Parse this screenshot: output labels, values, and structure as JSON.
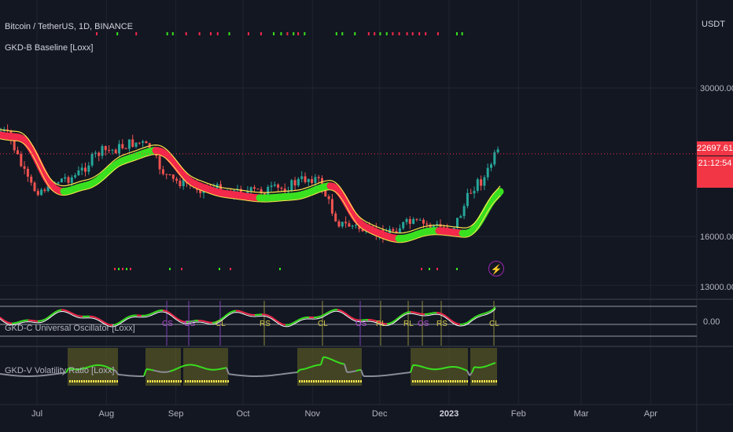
{
  "header": {
    "symbol": "Bitcoin / TetherUS, 1D, BINANCE",
    "indicator": "GKD-B Baseline [Loxx]",
    "quote_currency": "USDT"
  },
  "panes": {
    "oscillator_label": "GKD-C Universal Oscillator [Loxx]",
    "volatility_label": "GKD-V Volatility Ratio [Loxx]"
  },
  "price_axis": {
    "ticks": [
      "30000.00",
      "16000.00",
      "13000.00"
    ],
    "oscillator_tick": "0.00"
  },
  "last_price": {
    "value": "22697.61",
    "countdown": "21:12:54",
    "color": "#f23645"
  },
  "time_axis": {
    "labels": [
      "Jul",
      "Aug",
      "Sep",
      "Oct",
      "Nov",
      "Dec",
      "2023",
      "Feb",
      "Mar",
      "Apr"
    ]
  },
  "oscillator_signals": [
    "CS",
    "OS",
    "CL",
    "RS",
    "CL",
    "OS",
    "RL",
    "RL",
    "OS",
    "RS",
    "CL"
  ],
  "colors": {
    "background": "#131722",
    "bull": "#39e01f",
    "bear": "#f2294a",
    "signal_line": "#ffe84d",
    "volatility_zone": "#6b6a27",
    "grid": "#1f2430"
  },
  "chart_data": {
    "type": "line",
    "x": [
      "2022-06-15",
      "2022-07-01",
      "2022-07-15",
      "2022-08-01",
      "2022-08-15",
      "2022-09-01",
      "2022-09-15",
      "2022-10-01",
      "2022-10-15",
      "2022-11-01",
      "2022-11-15",
      "2022-12-01",
      "2022-12-15",
      "2023-01-01",
      "2023-01-15",
      "2023-01-23"
    ],
    "series": [
      {
        "values": [
          25000,
          19500,
          20500,
          23000,
          23800,
          20200,
          19600,
          19300,
          19500,
          20500,
          16800,
          16200,
          16900,
          16600,
          20200,
          22697
        ]
      }
    ],
    "ylim": [
      11000,
      36000
    ],
    "yticks": [
      30000,
      16000,
      13000
    ]
  }
}
